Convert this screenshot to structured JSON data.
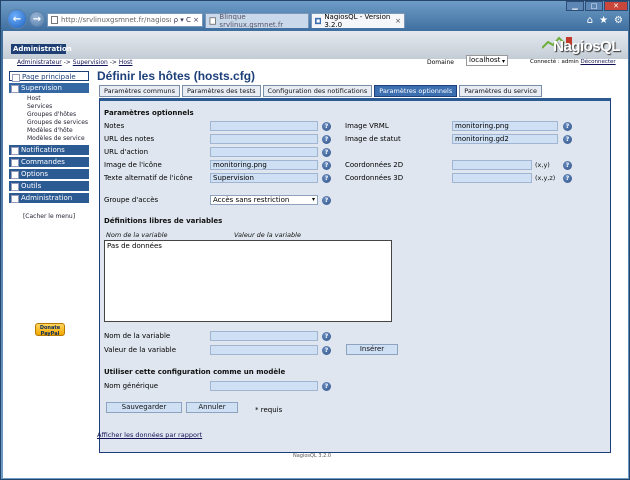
{
  "browser": {
    "address_url": "http://srvlinuxgsmnet.fr/nagiosql/ad",
    "address_controls": "ρ ▾ C ×",
    "tabs": [
      {
        "label": "Blinque srvlinux.gsmnet.fr"
      },
      {
        "label": "NagiosQL - Version 3.2.0"
      }
    ]
  },
  "header": {
    "section": "Administration",
    "logo_text": "NagiosQL",
    "breadcrumbs": [
      "Administrateur",
      "Supervision",
      "Host"
    ],
    "crumb_sep": " -> ",
    "domaine_label": "Domaine",
    "domaine_value": "localhost",
    "connected_prefix": "Connecté : admin",
    "disconnect": "Déconnecter"
  },
  "sidebar": {
    "menus": [
      {
        "label": "Page principale",
        "state": "active"
      },
      {
        "label": "Supervision",
        "state": "sub-active"
      }
    ],
    "sub_items": [
      "Host",
      "Services",
      "Groupes d'hôtes",
      "Groupes de services",
      "Modèles d'hôte",
      "Modèles de service"
    ],
    "menus2": [
      "Notifications",
      "Commandes",
      "Options",
      "Outils",
      "Administration"
    ],
    "hide_menu": "[Cacher le menu]",
    "donate_label": "Donate",
    "donate_sub": "PayPal"
  },
  "main": {
    "title": "Définir les hôtes (hosts.cfg)",
    "tabs": [
      "Paramètres communs",
      "Paramètres des tests",
      "Configuration des notifications",
      "Paramètres optionnels",
      "Paramètres du service"
    ],
    "active_tab": 3,
    "section_optional": "Paramètres optionnels",
    "left_fields": [
      {
        "label": "Notes",
        "value": ""
      },
      {
        "label": "URL des notes",
        "value": ""
      },
      {
        "label": "URL d'action",
        "value": ""
      },
      {
        "label": "Image de l'icône",
        "value": "monitoring.png"
      },
      {
        "label": "Texte alternatif de l'icône",
        "value": "Supervision"
      }
    ],
    "right_fields": [
      {
        "label": "Image VRML",
        "value": "monitoring.png"
      },
      {
        "label": "Image de statut",
        "value": "monitoring.gd2"
      }
    ],
    "coord2d_label": "Coordonnées 2D",
    "coord2d_unit": "(x,y)",
    "coord3d_label": "Coordonnées 3D",
    "coord3d_unit": "(x,y,z)",
    "access_label": "Groupe d'accès",
    "access_value": "Accès sans restriction",
    "section_vars": "Définitions libres de variables",
    "col_name": "Nom de la variable",
    "col_value": "Valeur de la variable",
    "no_data": "Pas de données",
    "var_name_label": "Nom de la variable",
    "var_value_label": "Valeur de la variable",
    "insert_button": "Insérer",
    "section_template": "Utiliser cette configuration comme un modèle",
    "generic_name_label": "Nom générique",
    "save_button": "Sauvegarder",
    "cancel_button": "Annuler",
    "required_note": "* requis",
    "show_data_link": "Afficher les données par rapport",
    "footer": "NagiosQL 3.2.0"
  }
}
